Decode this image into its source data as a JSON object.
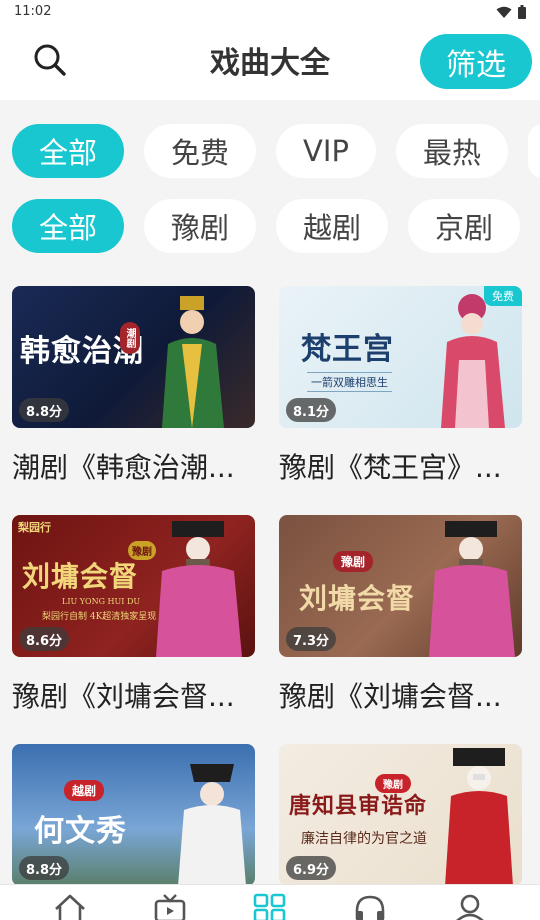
{
  "status": {
    "time": "11:02"
  },
  "header": {
    "title": "戏曲大全",
    "filter_label": "筛选"
  },
  "filters": {
    "price": [
      "全部",
      "免费",
      "VIP",
      "最热"
    ],
    "genre": [
      "全部",
      "豫剧",
      "越剧",
      "京剧"
    ]
  },
  "colors": {
    "accent": "#18c7d0"
  },
  "cards": [
    {
      "title": "潮剧《韩愈治潮...",
      "rating": "8.8分",
      "art": "韩愈治潮",
      "art_tag": "潮剧"
    },
    {
      "title": "豫剧《梵王宫》...",
      "rating": "8.1分",
      "art": "梵王宫",
      "art_sub": "一箭双雕相思生",
      "badge": "免费"
    },
    {
      "title": "豫剧《刘墉会督...",
      "rating": "8.6分",
      "art": "刘墉会督",
      "art_tag": "豫剧",
      "art_brand": "梨园行",
      "art_pinyin": "LIU YONG HUI DU",
      "art_sub": "梨园行自制 4K超清独家呈现"
    },
    {
      "title": "豫剧《刘墉会督...",
      "rating": "7.3分",
      "art": "刘墉会督",
      "art_tag": "豫剧"
    },
    {
      "title": "",
      "rating": "8.8分",
      "art": "何文秀",
      "art_tag": "越剧"
    },
    {
      "title": "",
      "rating": "6.9分",
      "art": "唐知县审诰命",
      "art_tag": "豫剧",
      "art_sub": "廉洁自律的为官之道"
    }
  ],
  "tabbar": {
    "icons": [
      "home-icon",
      "tv-icon",
      "grid-icon",
      "headphones-icon",
      "user-icon"
    ]
  }
}
